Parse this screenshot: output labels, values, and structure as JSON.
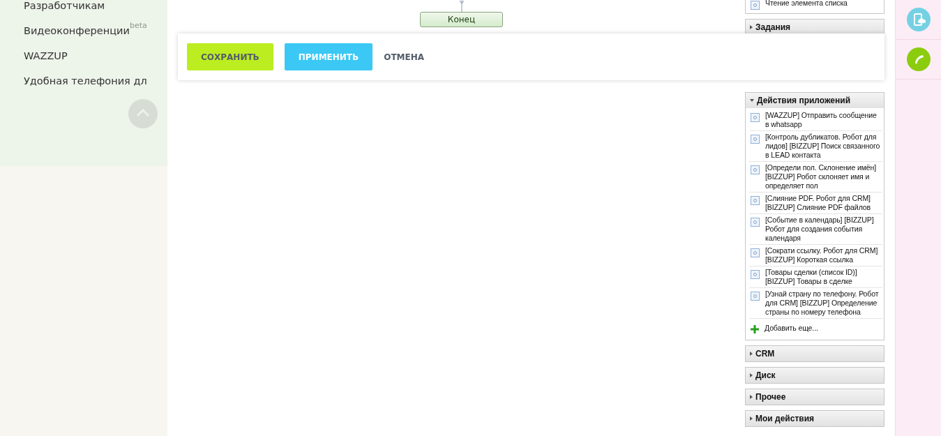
{
  "sidebar": {
    "items": [
      {
        "label": "Разработчикам"
      },
      {
        "label": "Видеоконференции",
        "badge": "beta"
      },
      {
        "label": "WAZZUP"
      },
      {
        "label": "Удобная телефония дл"
      }
    ]
  },
  "diagram": {
    "end_node": "Конец"
  },
  "action_bar": {
    "buttons": [
      {
        "label": "СОХРАНИТЬ",
        "kind": "save"
      },
      {
        "label": "ПРИМЕНИТЬ",
        "kind": "apply"
      },
      {
        "label": "ОТМЕНА",
        "kind": "cancel"
      }
    ]
  },
  "activity_panel": {
    "top_items": [
      {
        "label": "Чтение элемента списка"
      }
    ],
    "groups": [
      {
        "title": "Задания",
        "expanded": false
      },
      {
        "title": "Действия приложений",
        "expanded": true,
        "items": [
          {
            "label": "[WAZZUP] Отправить сообщение в whatsapp"
          },
          {
            "label": "[Контроль дубликатов. Робот для лидов] [BIZZUP] Поиск связанного в LEAD контакта"
          },
          {
            "label": "[Определи пол. Склонение имён] [BIZZUP] Робот склоняет имя и определяет пол"
          },
          {
            "label": "[Слияние PDF. Робот для CRM] [BIZZUP] Слияние PDF файлов"
          },
          {
            "label": "[Событие в календарь] [BIZZUP] Робот для создания события календаря"
          },
          {
            "label": "[Сократи ссылку. Робот для CRM] [BIZZUP] Короткая ссылка"
          },
          {
            "label": "[Товары сделки (список ID)] [BIZZUP] Товары в сделке"
          },
          {
            "label": "[Узнай страну по телефону. Робот для CRM] [BIZZUP] Определение страны по номеру телефона"
          }
        ],
        "add_link": "Добавить еще..."
      },
      {
        "title": "CRM",
        "expanded": false
      },
      {
        "title": "Диск",
        "expanded": false
      },
      {
        "title": "Прочее",
        "expanded": false
      },
      {
        "title": "Мои действия",
        "expanded": false
      }
    ]
  }
}
